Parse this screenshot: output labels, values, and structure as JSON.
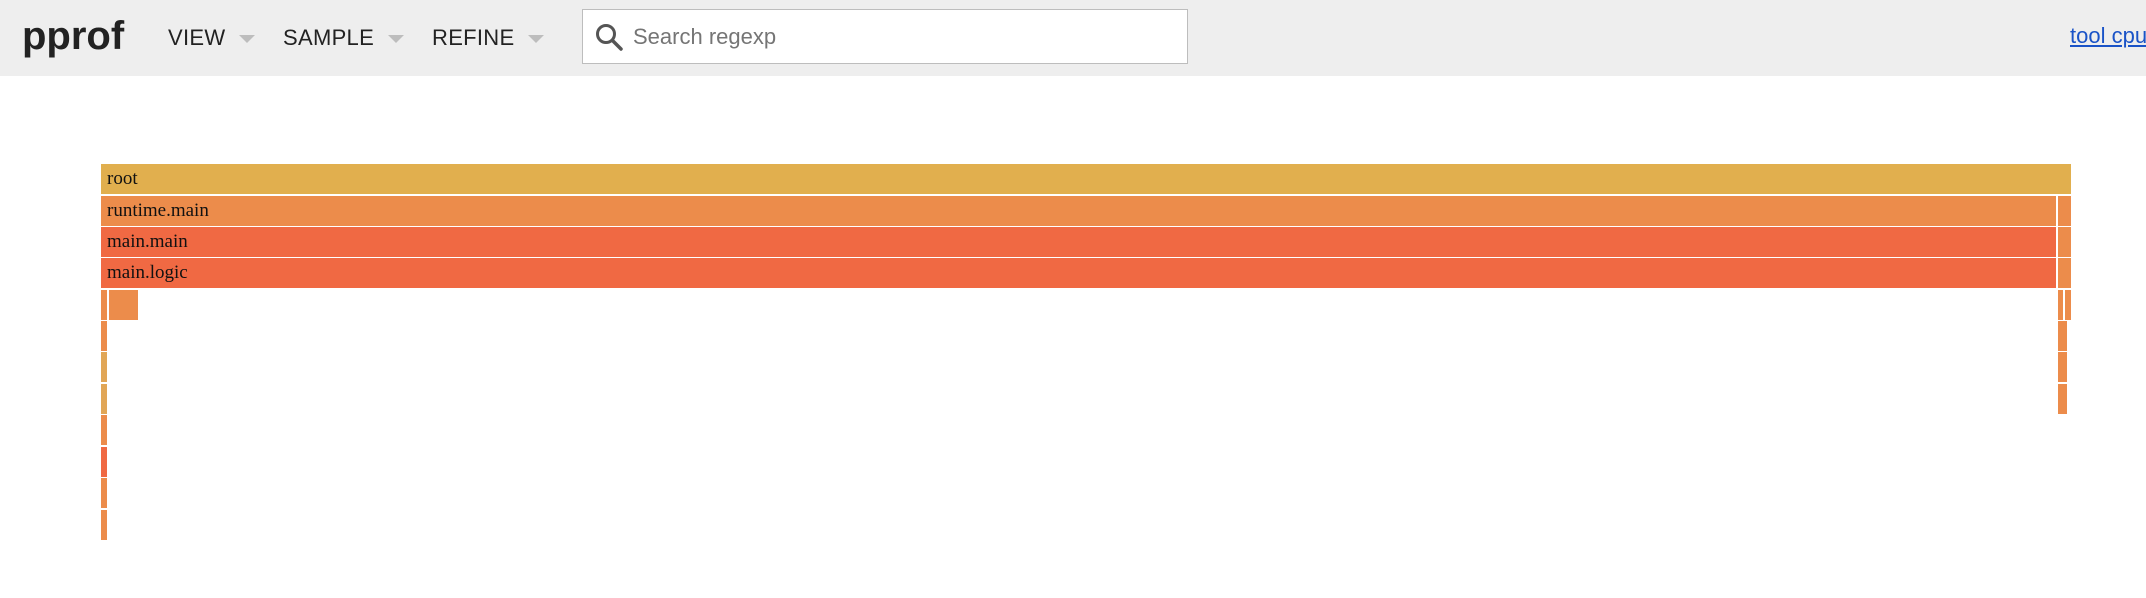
{
  "app": {
    "title": "pprof"
  },
  "menus": [
    {
      "label": "VIEW"
    },
    {
      "label": "SAMPLE"
    },
    {
      "label": "REFINE"
    }
  ],
  "search": {
    "placeholder": "Search regexp",
    "value": "",
    "icon": "search-icon"
  },
  "top_link": {
    "label": "tool cpu"
  },
  "colors": {
    "header_bg": "#eeeeee",
    "link": "#1a53c7",
    "frame_yellow": "#e1af4e",
    "frame_orange": "#ec8c4b",
    "frame_red": "#f06943"
  },
  "flamegraph": {
    "frames": [
      {
        "label": "root",
        "color": "#e1af4e"
      },
      {
        "label": "runtime.main",
        "color": "#ec8c4b"
      },
      {
        "label": "",
        "color": "#ec8c4b"
      },
      {
        "label": "main.main",
        "color": "#f06943"
      },
      {
        "label": "",
        "color": "#ec8c4b"
      },
      {
        "label": "main.logic",
        "color": "#f06943"
      },
      {
        "label": "",
        "color": "#ec8c4b"
      },
      {
        "label": "",
        "color": "#ec8c4b"
      },
      {
        "label": "",
        "color": "#ec8c4b"
      },
      {
        "label": "",
        "color": "#ec8c4b"
      },
      {
        "label": "",
        "color": "#ec8c4b"
      },
      {
        "label": "",
        "color": "#ec8c4b"
      },
      {
        "label": "",
        "color": "#e1a656"
      },
      {
        "label": "",
        "color": "#e1a656"
      },
      {
        "label": "",
        "color": "#ec8c4b"
      },
      {
        "label": "",
        "color": "#f06943"
      },
      {
        "label": "",
        "color": "#ec8c4b"
      },
      {
        "label": "",
        "color": "#ec8c4b"
      },
      {
        "label": "",
        "color": "#ec8c4b"
      },
      {
        "label": "",
        "color": "#ec8c4b"
      },
      {
        "label": "",
        "color": "#ec8c4b"
      }
    ]
  }
}
